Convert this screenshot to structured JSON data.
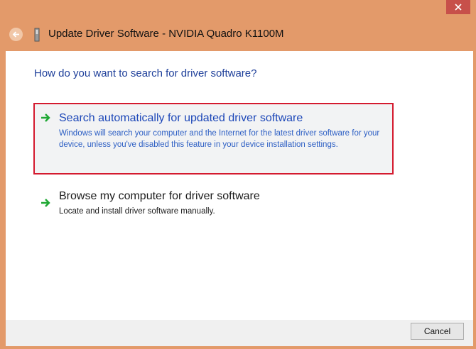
{
  "window": {
    "title": "Update Driver Software - NVIDIA Quadro K1100M"
  },
  "dialog": {
    "heading": "How do you want to search for driver software?",
    "options": [
      {
        "title": "Search automatically for updated driver software",
        "description": "Windows will search your computer and the Internet for the latest driver software for your device, unless you've disabled this feature in your device installation settings."
      },
      {
        "title": "Browse my computer for driver software",
        "description": "Locate and install driver software manually."
      }
    ]
  },
  "footer": {
    "cancel_label": "Cancel"
  },
  "colors": {
    "chrome": "#e39a6a",
    "close": "#c7504a",
    "highlight_frame": "#d41a2f",
    "link": "#1c47b8"
  },
  "icons": {
    "back": "back-arrow-icon",
    "device": "device-icon",
    "option_arrow": "green-arrow-icon",
    "close": "close-icon"
  }
}
